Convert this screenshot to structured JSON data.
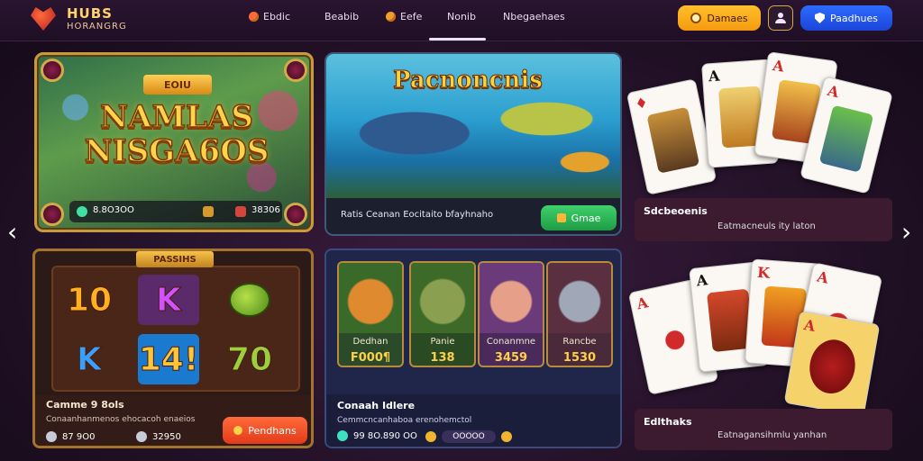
{
  "header": {
    "logo_line1": "HUBS",
    "logo_line2": "HORANGRG",
    "nav": [
      {
        "label": "Ebdic",
        "icon": "flame-icon"
      },
      {
        "label": "Beabib",
        "icon": ""
      },
      {
        "label": "Eefe",
        "icon": "coin-icon"
      },
      {
        "label": "Nonib",
        "icon": ""
      },
      {
        "label": "Nbegaehaes",
        "icon": ""
      }
    ],
    "active_nav": "Nonib",
    "deposit_label": "Damaes",
    "login_label": "Paadhues"
  },
  "cards": {
    "slots": {
      "ribbon": "EOIU",
      "title": "NAMLAS NISGA6OS",
      "value1": "8.8O3OO",
      "value2": "38306"
    },
    "fishing": {
      "title": "Pacnoncnis",
      "description": "Ratis Ceanan Eocitaito bfayhnaho",
      "button": "Gmae"
    },
    "poker_top": {
      "title": "Sdcbeoenis",
      "subtitle": "Eatmacneuls ity laton",
      "ranks": [
        "A",
        "A",
        "A",
        "A"
      ]
    },
    "symbols": {
      "ribbon": "PASSIHS",
      "grid": [
        "10",
        "K",
        "",
        "K",
        "14!",
        "70"
      ],
      "title": "Camme 9 8ols",
      "subtitle": "Conaanhanmenos ehocacoh enaeios",
      "value1": "87 9O0",
      "value2": "32950",
      "button": "Pendhans"
    },
    "characters": {
      "items": [
        {
          "name": "Dedhan",
          "value": "F000¶"
        },
        {
          "name": "Panie",
          "value": "138"
        },
        {
          "name": "Conanmne",
          "value": "3459"
        },
        {
          "name": "Rancbe",
          "value": "1530"
        }
      ],
      "title": "Conaah Idlere",
      "subtitle": "Cemmcncanhaboa erenohemctol",
      "value1": "99 8O.890 OO",
      "value2_pill": "OOOOO"
    },
    "poker_bottom": {
      "title": "Edlthaks",
      "subtitle": "Eatnagansihmlu yanhan",
      "ranks": [
        "A",
        "A",
        "K",
        "A",
        "A"
      ]
    }
  },
  "colors": {
    "accent_gold": "#ffd34a",
    "deposit_orange": "#f49a10",
    "login_blue": "#1a46d8",
    "play_green": "#1f9c45",
    "cta_red": "#e33a1a"
  }
}
